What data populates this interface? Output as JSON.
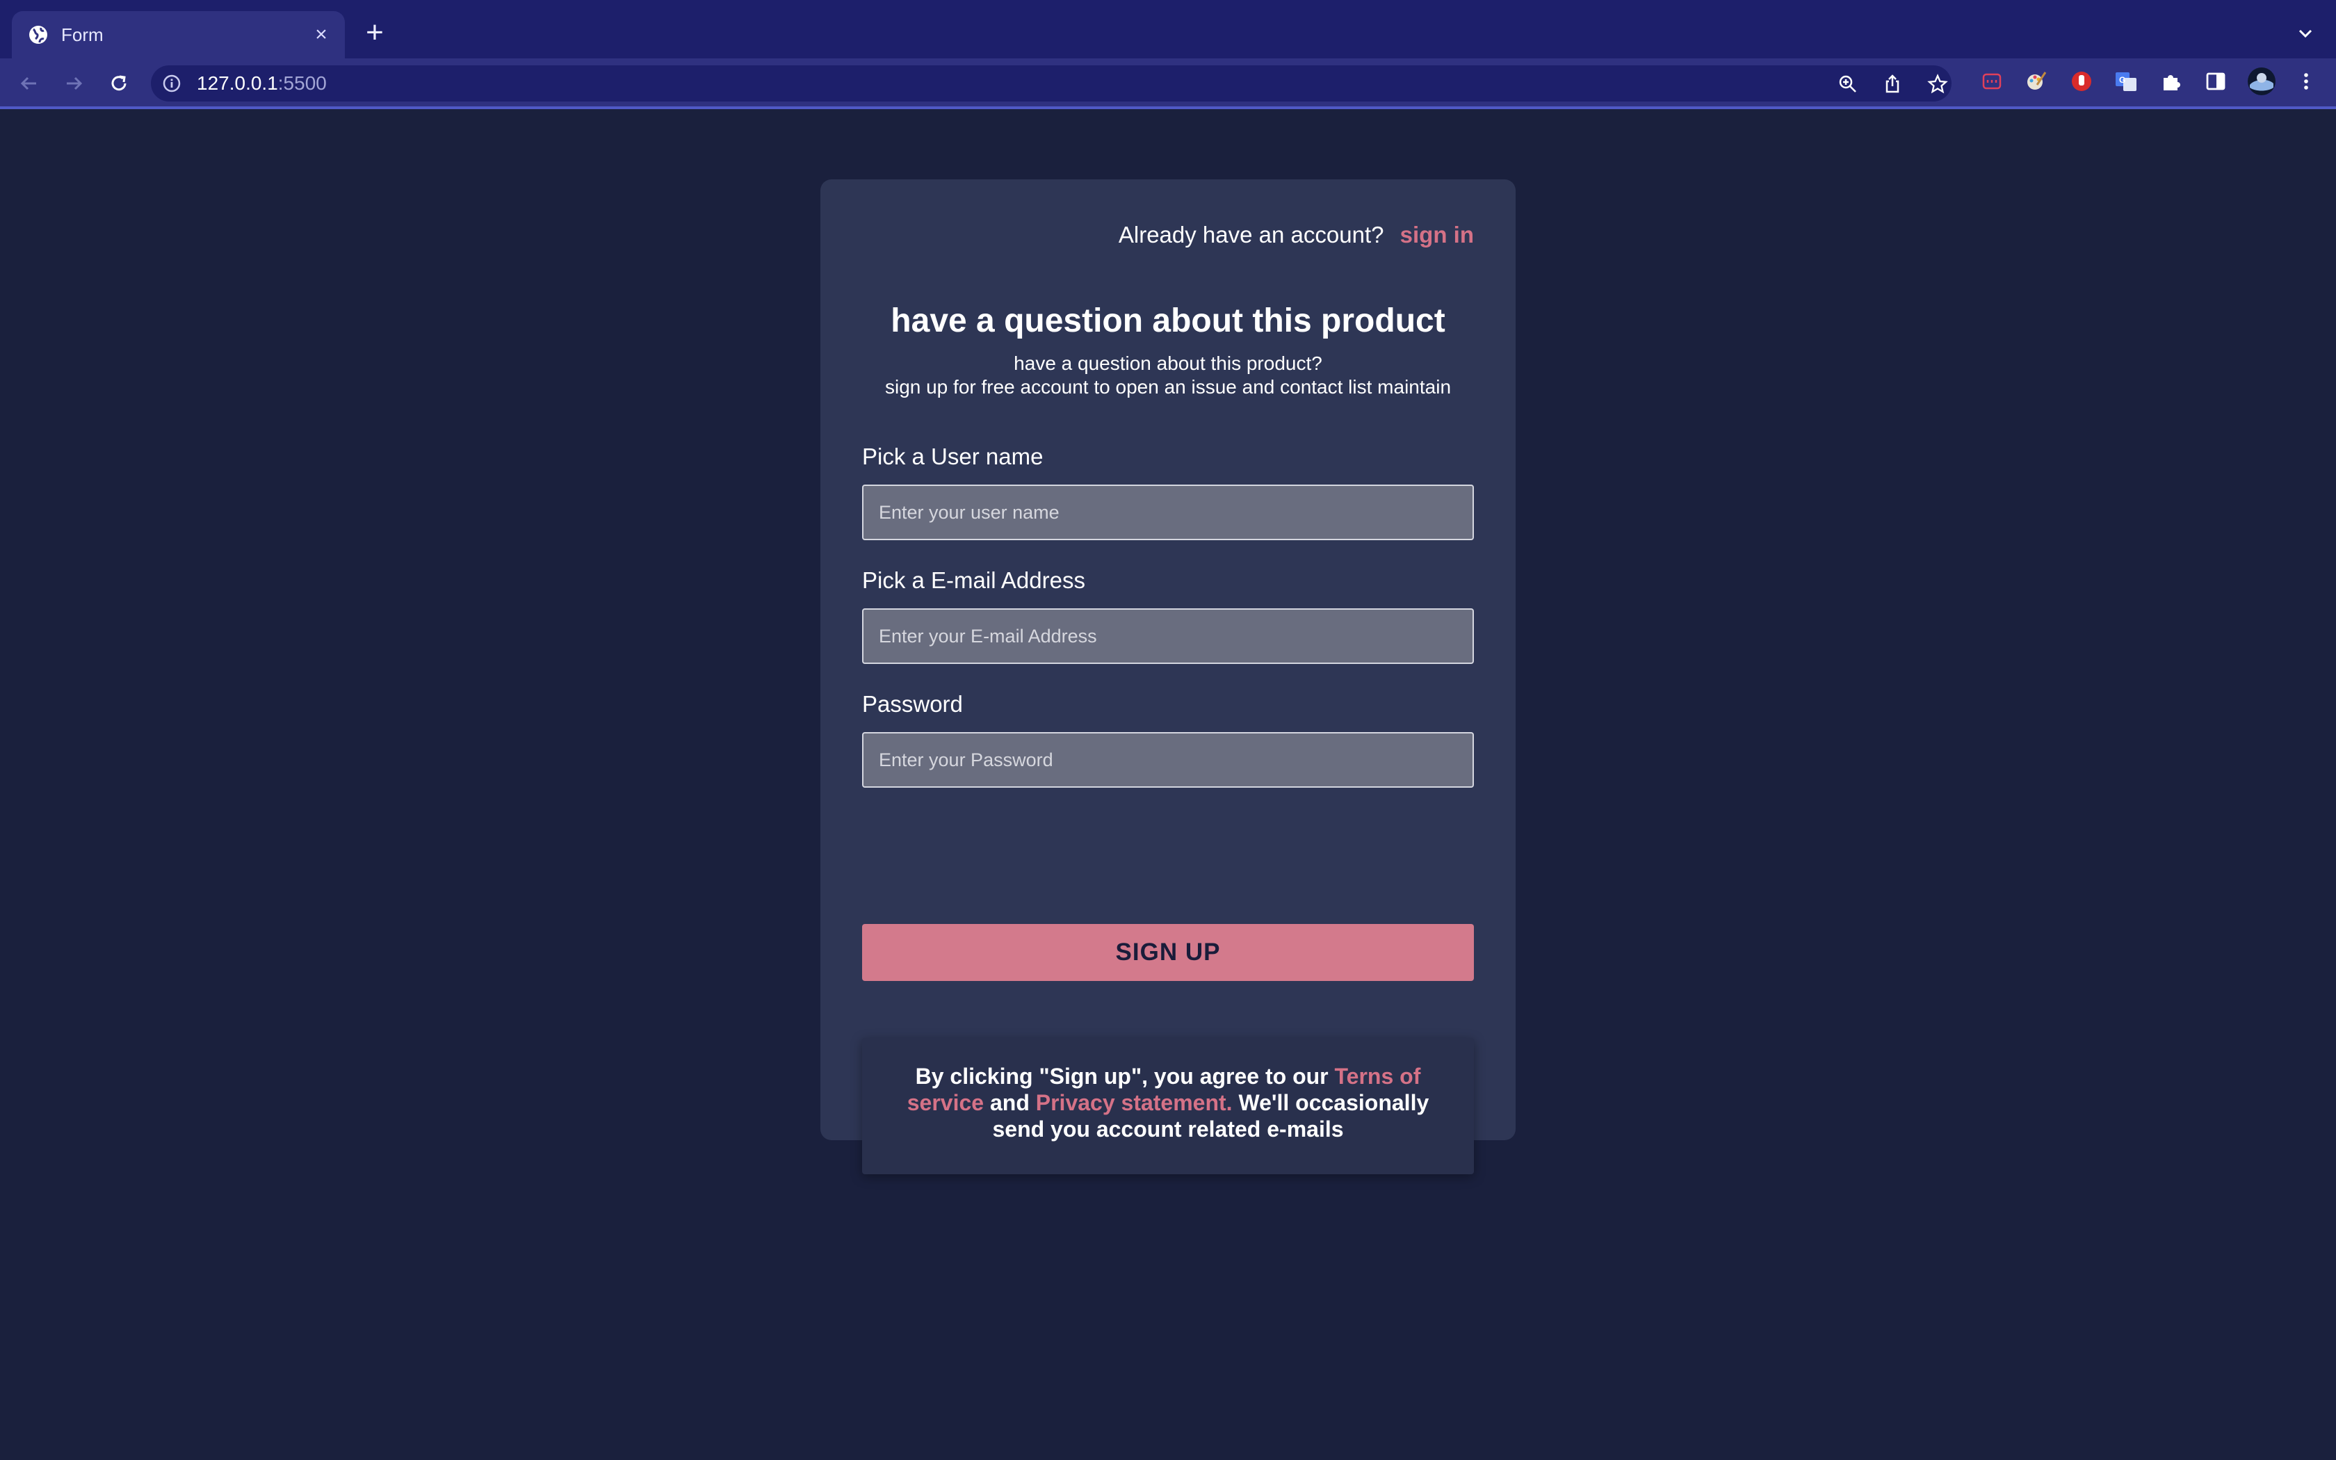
{
  "browser": {
    "tab_title": "Form",
    "tab_close": "×",
    "new_tab": "+",
    "url_host": "127.0.0.1",
    "url_port": ":5500"
  },
  "form": {
    "signin_prompt": "Already have an account?",
    "signin_link": "sign in",
    "title": "have a question about this product",
    "subtitle_line1": "have a question about this product?",
    "subtitle_line2": "sign up for free account to open an issue and contact list maintain",
    "username_label": "Pick a User name",
    "username_placeholder": "Enter your user name",
    "username_value": "",
    "email_label": "Pick a E-mail Address",
    "email_placeholder": "Enter your E-mail Address",
    "email_value": "",
    "password_label": "Password",
    "password_placeholder": "Enter your Password",
    "password_value": "",
    "signup_button": "SIGN UP"
  },
  "terms": {
    "text_before": "By clicking \"Sign up\", you agree to our ",
    "terms_link": "Terns of service",
    "text_middle": " and ",
    "privacy_link": "Privacy statement.",
    "text_after": " We'll occasionally send you account related e-mails"
  },
  "colors": {
    "accent": "#d57287",
    "page_bg": "#1a203d",
    "card_bg": "#2e3655",
    "browser_frame": "#1d1f6b"
  },
  "icons": {
    "favicon": "globe-icon",
    "back": "arrow-left-icon",
    "forward": "arrow-right-icon",
    "reload": "reload-icon",
    "site_info": "info-icon",
    "zoom": "zoom-icon",
    "share": "share-icon",
    "bookmark": "star-icon",
    "extensions": "puzzle-icon",
    "side_panel": "side-panel-icon",
    "profile": "avatar",
    "menu": "kebab-menu-icon"
  }
}
